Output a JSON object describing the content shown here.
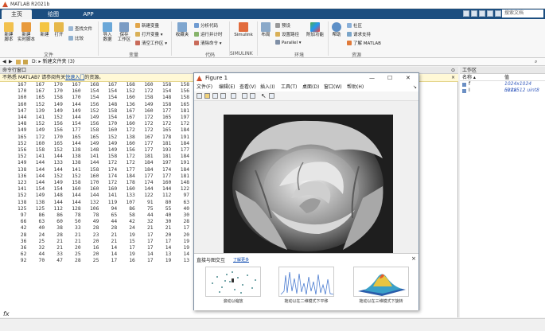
{
  "app": {
    "title": "MATLAB R2021b"
  },
  "tabs": [
    "主页",
    "绘图",
    "APP"
  ],
  "search_placeholder": "搜索文档",
  "ribbon": {
    "file": {
      "new_script": "新建\n脚本",
      "new_live_script": "新建\n实时脚本",
      "new": "新建",
      "open": "打开",
      "find_files": "查找文件",
      "compare": "比较",
      "group": "文件"
    },
    "variable": {
      "import_data": "导入\n数据",
      "save_workspace": "保存\n工作区",
      "new_variable": "新建变量",
      "open_variable": "打开变量 ▾",
      "clear_workspace": "清空工作区 ▾",
      "group": "变量"
    },
    "code": {
      "favorites": "收藏夹",
      "analyze_code": "分析代码",
      "run_and_time": "运行并计时",
      "clear_commands": "清除命令 ▾",
      "group": "代码"
    },
    "simulink": {
      "simulink": "Simulink",
      "group": "SIMULINK"
    },
    "environment": {
      "layout": "布局",
      "preferences": "预设",
      "set_path": "设置路径",
      "parallel": "Parallel ▾",
      "addons": "附加功能",
      "group": "环境"
    },
    "resources": {
      "help": "帮助",
      "community": "社区",
      "request_support": "请求支持",
      "learn_matlab": "了解 MATLAB",
      "group": "资源"
    }
  },
  "address": {
    "path": "D: ▸ 新建文件夹 (3)"
  },
  "command_window": {
    "title": "命令行窗口",
    "notice_prefix": "不熟悉 MATLAB? 请参阅有关",
    "notice_link": "快速入门",
    "notice_suffix": "的资源。",
    "lines": [
      "167   167   170   167   168   167   168   160   158   158",
      "170   167   170   160   154   154   152   172   154   156",
      "160   165   158   170   154   154   160   158   148   158",
      "160   152   149   144   156   148   136   149   158   165",
      "147   139   149   149   152   158   167   160   177   181",
      "144   141   152   144   149   154   167   172   165   197",
      "148   152   156   154   156   170   160   172   172   172",
      "149   149   156   177   158   160   172   172   165   184",
      "165   172   170   165   165   152   138   167   178   191",
      "152   160   165   144   149   149   160   177   181   184",
      "156   158   152   138   148   149   156   177   193   177",
      "152   141   144   138   141   158   172   181   181   184",
      "149   144   133   138   144   172   172   184   197   191",
      "138   144   144   141   158   174   177   184   174   184",
      "136   144   152   152   160   174   184   177   177   181",
      "123   144   149   158   170   172   178   174   160   148",
      "141   154   154   160   160   160   160   144   144   122",
      "152   149   148   144   144   141   133   122   112    97",
      "138   138   144   144   132   119   107    91    80    63",
      "125   125   112   128   106    94    86    75    55    40",
      " 97    86    86    78    78    65    58    44    40    30",
      " 66    63    60    50    49    44    42    32    30    28",
      " 42    40    38    33    28    28    24    21    21    17",
      " 28    24    28    21    23    21    19    17    20    20",
      " 36    25    21    21    20    21    15    17    17    19",
      " 36    32    21    20    16    14    17    17    14    19",
      " 62    44    33    25    20    14    19    14    13    14",
      " 92    70    47    28    25    17    16    17    19    13    16    14"
    ],
    "prompt": "fx"
  },
  "workspace": {
    "title": "工作区",
    "col_name": "名称 ▴",
    "col_value": "值",
    "rows": [
      {
        "name": "f",
        "value": "1024x1024 uint8"
      },
      {
        "name": "I",
        "value": "512x512 uint8"
      }
    ]
  },
  "figure": {
    "title": "Figure 1",
    "menus": [
      "文件(F)",
      "编辑(E)",
      "查看(V)",
      "插入(I)",
      "工具(T)",
      "桌面(D)",
      "窗口(W)",
      "帮助(H)"
    ],
    "panel_title": "直接与图交互",
    "panel_link": "了解更多",
    "thumbs": [
      "滚动以缩放",
      "拖动以在二维模式下平移",
      "拖动以在三维模式下旋转"
    ]
  }
}
